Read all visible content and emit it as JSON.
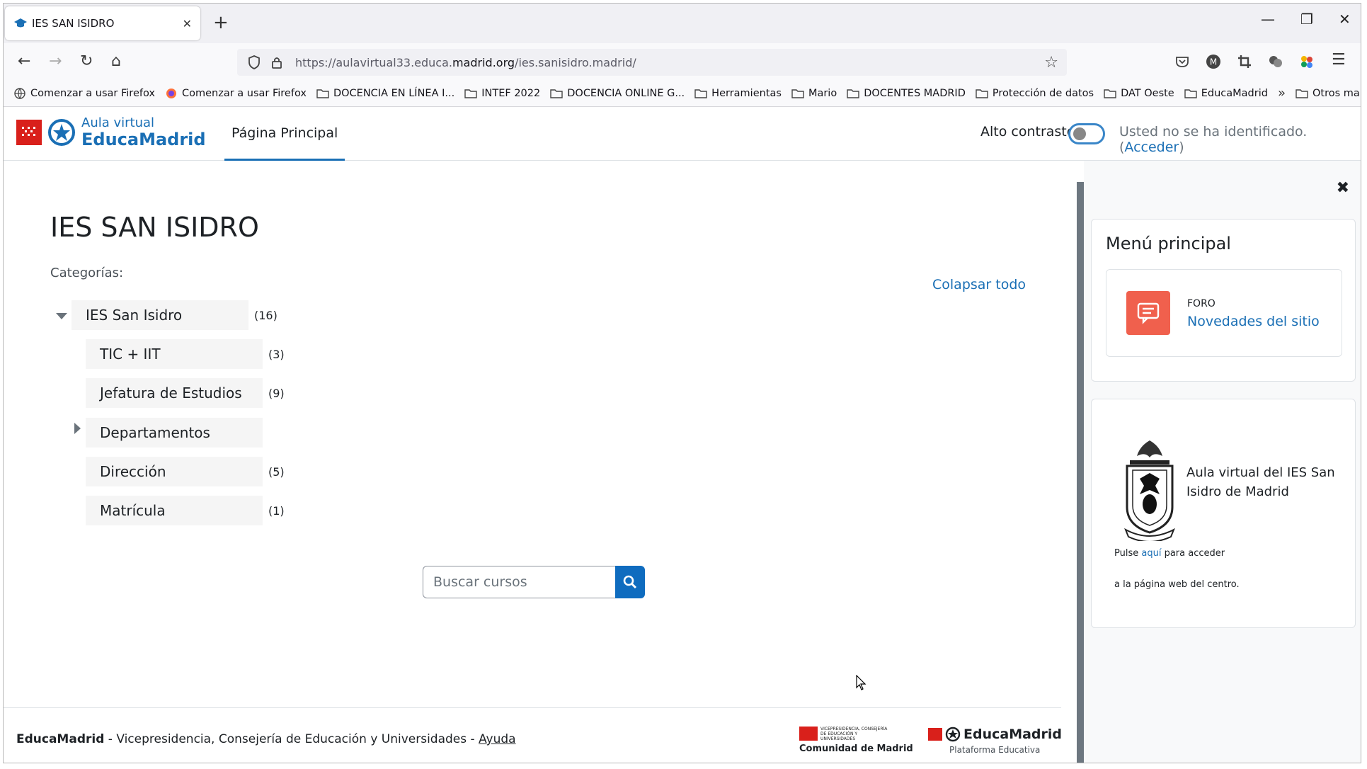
{
  "browser": {
    "tab_title": "IES SAN ISIDRO",
    "url_prefix": "https://aulavirtual33.educa.",
    "url_domain": "madrid.org",
    "url_path": "/ies.sanisidro.madrid/",
    "bookmarks": [
      {
        "label": "Comenzar a usar Firefox",
        "icon": "globe-icon"
      },
      {
        "label": "Comenzar a usar Firefox",
        "icon": "firefox-icon"
      },
      {
        "label": "DOCENCIA EN LÍNEA I...",
        "icon": "folder-icon"
      },
      {
        "label": "INTEF 2022",
        "icon": "folder-icon"
      },
      {
        "label": "DOCENCIA ONLINE G...",
        "icon": "folder-icon"
      },
      {
        "label": "Herramientas",
        "icon": "folder-icon"
      },
      {
        "label": "Mario",
        "icon": "folder-icon"
      },
      {
        "label": "DOCENTES MADRID",
        "icon": "folder-icon"
      },
      {
        "label": "Protección de datos",
        "icon": "folder-icon"
      },
      {
        "label": "DAT Oeste",
        "icon": "folder-icon"
      },
      {
        "label": "EducaMadrid",
        "icon": "folder-icon"
      }
    ],
    "other_bookmarks": "Otros marcadores"
  },
  "header": {
    "logo_top": "Aula virtual",
    "logo_main": "EducaMadrid",
    "nav_home": "Página Principal",
    "contrast_label": "Alto contraste",
    "login_text": "Usted no se ha identificado. (",
    "login_link": "Acceder",
    "login_close": ")"
  },
  "main": {
    "title": "IES SAN ISIDRO",
    "categories_label": "Categorías:",
    "collapse_all": "Colapsar todo",
    "root_category": {
      "name": "IES San Isidro",
      "count": "(16)"
    },
    "subcategories": [
      {
        "name": "TIC + IIT",
        "count": "(3)"
      },
      {
        "name": "Jefatura de Estudios",
        "count": "(9)"
      },
      {
        "name": "Departamentos",
        "count": ""
      },
      {
        "name": "Dirección",
        "count": "(5)"
      },
      {
        "name": "Matrícula",
        "count": "(1)"
      }
    ],
    "search_placeholder": "Buscar cursos"
  },
  "footer": {
    "brand": "EducaMadrid",
    "text": " - Vicepresidencia, Consejería de Educación y Universidades - ",
    "help": "Ayuda",
    "cm_small": "VICEPRESIDENCIA, CONSEJERÍA DE EDUCACIÓN Y UNIVERSIDADES",
    "cm_name": "Comunidad de Madrid",
    "em_name": "EducaMadrid",
    "em_sub": "Plataforma Educativa"
  },
  "drawer": {
    "menu_title": "Menú principal",
    "activity_type": "FORO",
    "activity_name": "Novedades del sitio",
    "school_text": "Aula virtual del IES San Isidro de Madrid",
    "pulse_pre": "Pulse ",
    "pulse_link": "aquí",
    "pulse_post": " para acceder",
    "pulse_line2": "a la página web del centro."
  },
  "colors": {
    "accent": "#1a6fb5",
    "brand_red": "#d9201b",
    "forum_icon": "#f0604d",
    "search_button": "#0f6cbf"
  }
}
